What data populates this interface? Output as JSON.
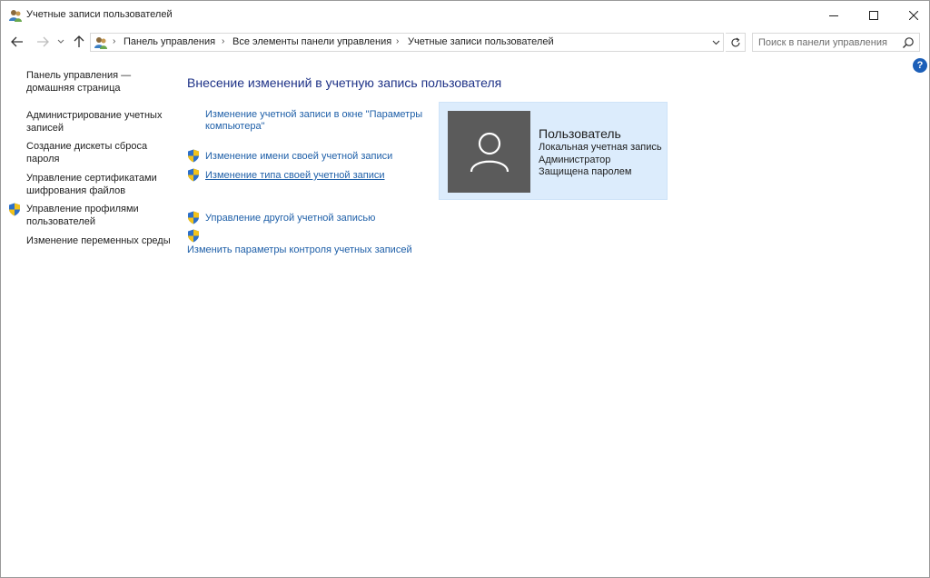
{
  "window": {
    "title": "Учетные записи пользователей"
  },
  "address": {
    "breadcrumbs": [
      "Панель управления",
      "Все элементы панели управления",
      "Учетные записи пользователей"
    ]
  },
  "search": {
    "placeholder": "Поиск в панели управления"
  },
  "help": {
    "label": "?"
  },
  "sidebar": {
    "items": [
      {
        "label": "Панель управления — домашняя страница",
        "shield": false
      },
      {
        "label": "Администрирование учетных записей",
        "shield": false
      },
      {
        "label": "Создание дискеты сброса пароля",
        "shield": false
      },
      {
        "label": "Управление сертификатами шифрования файлов",
        "shield": false
      },
      {
        "label": "Управление профилями пользователей",
        "shield": true
      },
      {
        "label": "Изменение переменных среды",
        "shield": false
      }
    ]
  },
  "main": {
    "heading": "Внесение изменений в учетную запись пользователя",
    "links": [
      {
        "label": "Изменение учетной записи в окне \"Параметры компьютера\"",
        "shield": false
      },
      {
        "label": "Изменение имени своей учетной записи",
        "shield": true
      },
      {
        "label": "Изменение типа своей учетной записи",
        "shield": true
      },
      {
        "label": "Управление другой учетной записью",
        "shield": true
      },
      {
        "label": "Изменить параметры контроля учетных записей",
        "shield": true
      }
    ]
  },
  "user": {
    "name": "Пользователь",
    "account_type": "Локальная учетная запись",
    "role": "Администратор",
    "password_status": "Защищена паролем"
  },
  "colors": {
    "link": "#1e5fa8",
    "heading": "#1e3287",
    "card_bg": "#dcecfc",
    "avatar_bg": "#5b5b5b",
    "help": "#1c5fb8"
  }
}
